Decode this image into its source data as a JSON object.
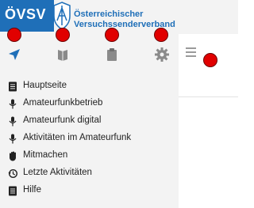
{
  "logo": {
    "text": "ÖVSV"
  },
  "organization": {
    "line1": "Österreichischer",
    "line2": "Versuchssenderverband"
  },
  "toolbar": {
    "icons": [
      "navigation-arrow-icon",
      "book-icon",
      "clipboard-icon",
      "gear-icon"
    ]
  },
  "nav": {
    "items": [
      {
        "label": "Hauptseite",
        "icon": "document-icon"
      },
      {
        "label": "Amateurfunkbetrieb",
        "icon": "microphone-icon"
      },
      {
        "label": "Amateurfunk digital",
        "icon": "microphone-icon"
      },
      {
        "label": "Aktivitäten im Amateurfunk",
        "icon": "microphone-icon"
      },
      {
        "label": "Mitmachen",
        "icon": "hand-icon"
      },
      {
        "label": "Letzte Aktivitäten",
        "icon": "history-icon"
      },
      {
        "label": "Hilfe",
        "icon": "document-icon"
      }
    ]
  },
  "colors": {
    "brand": "#1f6fb8",
    "sidebar_bg": "#f3f3f3",
    "active_icon": "#1f6fb8",
    "marker": "#e10000"
  },
  "markers": {
    "count": 5
  }
}
